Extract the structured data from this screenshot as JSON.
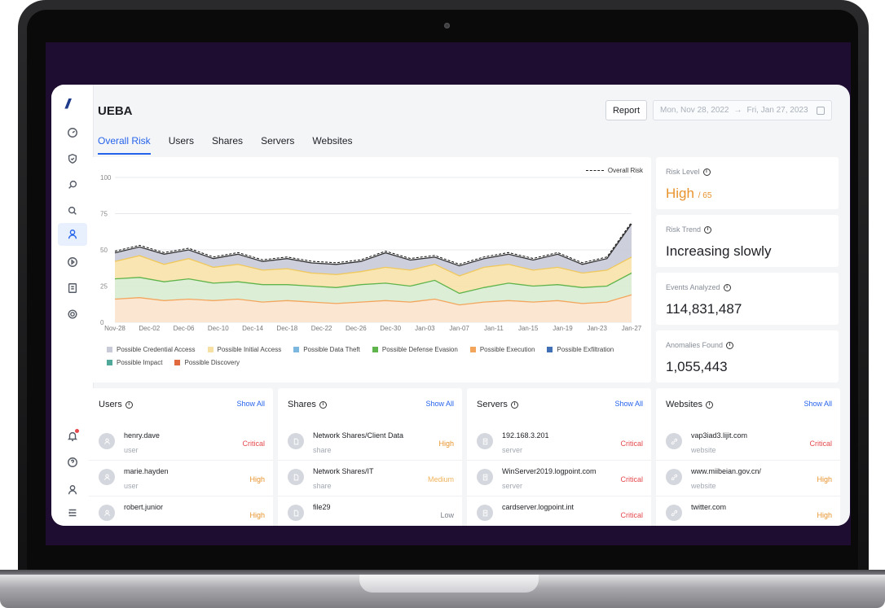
{
  "app": {
    "title": "UEBA",
    "report_label": "Report"
  },
  "date_range": {
    "start": "Mon, Nov 28, 2022",
    "arrow": "→",
    "end": "Fri, Jan 27, 2023"
  },
  "tabs": [
    {
      "label": "Overall Risk",
      "active": true
    },
    {
      "label": "Users"
    },
    {
      "label": "Shares"
    },
    {
      "label": "Servers"
    },
    {
      "label": "Websites"
    }
  ],
  "sidebar": {
    "icons": [
      "dashboard-icon",
      "shield-icon",
      "search-alt-icon",
      "search-icon",
      "user-icon",
      "play-icon",
      "report-icon",
      "settings-icon"
    ],
    "bottom_icons": [
      "bell-icon",
      "help-icon",
      "profile-icon",
      "collapse-icon"
    ]
  },
  "chart_data": {
    "type": "area",
    "x": [
      "Nov-28",
      "Dec-02",
      "Dec-06",
      "Dec-10",
      "Dec-14",
      "Dec-18",
      "Dec-22",
      "Dec-26",
      "Dec-30",
      "Jan-03",
      "Jan-07",
      "Jan-11",
      "Jan-15",
      "Jan-19",
      "Jan-23",
      "Jan-27"
    ],
    "ylim": [
      0,
      100
    ],
    "yticks": [
      0,
      25,
      50,
      75,
      100
    ],
    "legend_overall": "Overall Risk",
    "series": [
      {
        "name": "Possible Credential Access",
        "color": "#c9cad8"
      },
      {
        "name": "Possible Initial Access",
        "color": "#f7e0a3"
      },
      {
        "name": "Possible Data Theft",
        "color": "#7cb7e0"
      },
      {
        "name": "Possible Defense Evasion",
        "color": "#5fb44b"
      },
      {
        "name": "Possible Execution",
        "color": "#f3a55c"
      },
      {
        "name": "Possible Exfiltration",
        "color": "#3f6fb5"
      },
      {
        "name": "Possible Impact",
        "color": "#4fa89a"
      },
      {
        "name": "Possible Discovery",
        "color": "#e06a3e"
      }
    ],
    "overall": [
      48,
      52,
      47,
      50,
      44,
      47,
      42,
      44,
      41,
      40,
      42,
      48,
      43,
      45,
      39,
      44,
      47,
      43,
      47,
      40,
      44,
      68
    ],
    "initial_access": [
      42,
      46,
      40,
      44,
      38,
      40,
      36,
      37,
      34,
      33,
      35,
      38,
      36,
      40,
      32,
      38,
      40,
      36,
      38,
      34,
      36,
      45
    ],
    "defense_evasion": [
      30,
      31,
      28,
      30,
      27,
      28,
      26,
      26,
      25,
      24,
      26,
      27,
      25,
      29,
      20,
      24,
      27,
      25,
      26,
      24,
      25,
      34
    ],
    "execution": [
      16,
      17,
      15,
      16,
      15,
      16,
      14,
      15,
      14,
      13,
      14,
      15,
      14,
      16,
      12,
      14,
      15,
      14,
      15,
      13,
      14,
      19
    ]
  },
  "kpis": {
    "risk_level": {
      "label": "Risk Level",
      "value": "High",
      "sub": "/ 65"
    },
    "risk_trend": {
      "label": "Risk Trend",
      "value": "Increasing slowly"
    },
    "events": {
      "label": "Events Analyzed",
      "value": "114,831,487"
    },
    "anomalies": {
      "label": "Anomalies Found",
      "value": "1,055,443"
    }
  },
  "lists": {
    "users": {
      "title": "Users",
      "show_all": "Show All",
      "rows": [
        {
          "name": "henry.dave",
          "type": "user",
          "level": "Critical"
        },
        {
          "name": "marie.hayden",
          "type": "user",
          "level": "High"
        },
        {
          "name": "robert.junior",
          "type": "",
          "level": "High"
        }
      ]
    },
    "shares": {
      "title": "Shares",
      "show_all": "Show All",
      "rows": [
        {
          "name": "Network Shares/Client Data",
          "type": "share",
          "level": "High"
        },
        {
          "name": "Network Shares/IT",
          "type": "share",
          "level": "Medium"
        },
        {
          "name": "file29",
          "type": "",
          "level": "Low"
        }
      ]
    },
    "servers": {
      "title": "Servers",
      "show_all": "Show All",
      "rows": [
        {
          "name": "192.168.3.201",
          "type": "server",
          "level": "Critical"
        },
        {
          "name": "WinServer2019.logpoint.com",
          "type": "server",
          "level": "Critical"
        },
        {
          "name": "cardserver.logpoint.int",
          "type": "",
          "level": "Critical"
        }
      ]
    },
    "websites": {
      "title": "Websites",
      "show_all": "Show All",
      "rows": [
        {
          "name": "vap3iad3.lijit.com",
          "type": "website",
          "level": "Critical"
        },
        {
          "name": "www.miibeian.gov.cn/",
          "type": "website",
          "level": "High"
        },
        {
          "name": "twitter.com",
          "type": "",
          "level": "High"
        }
      ]
    }
  }
}
